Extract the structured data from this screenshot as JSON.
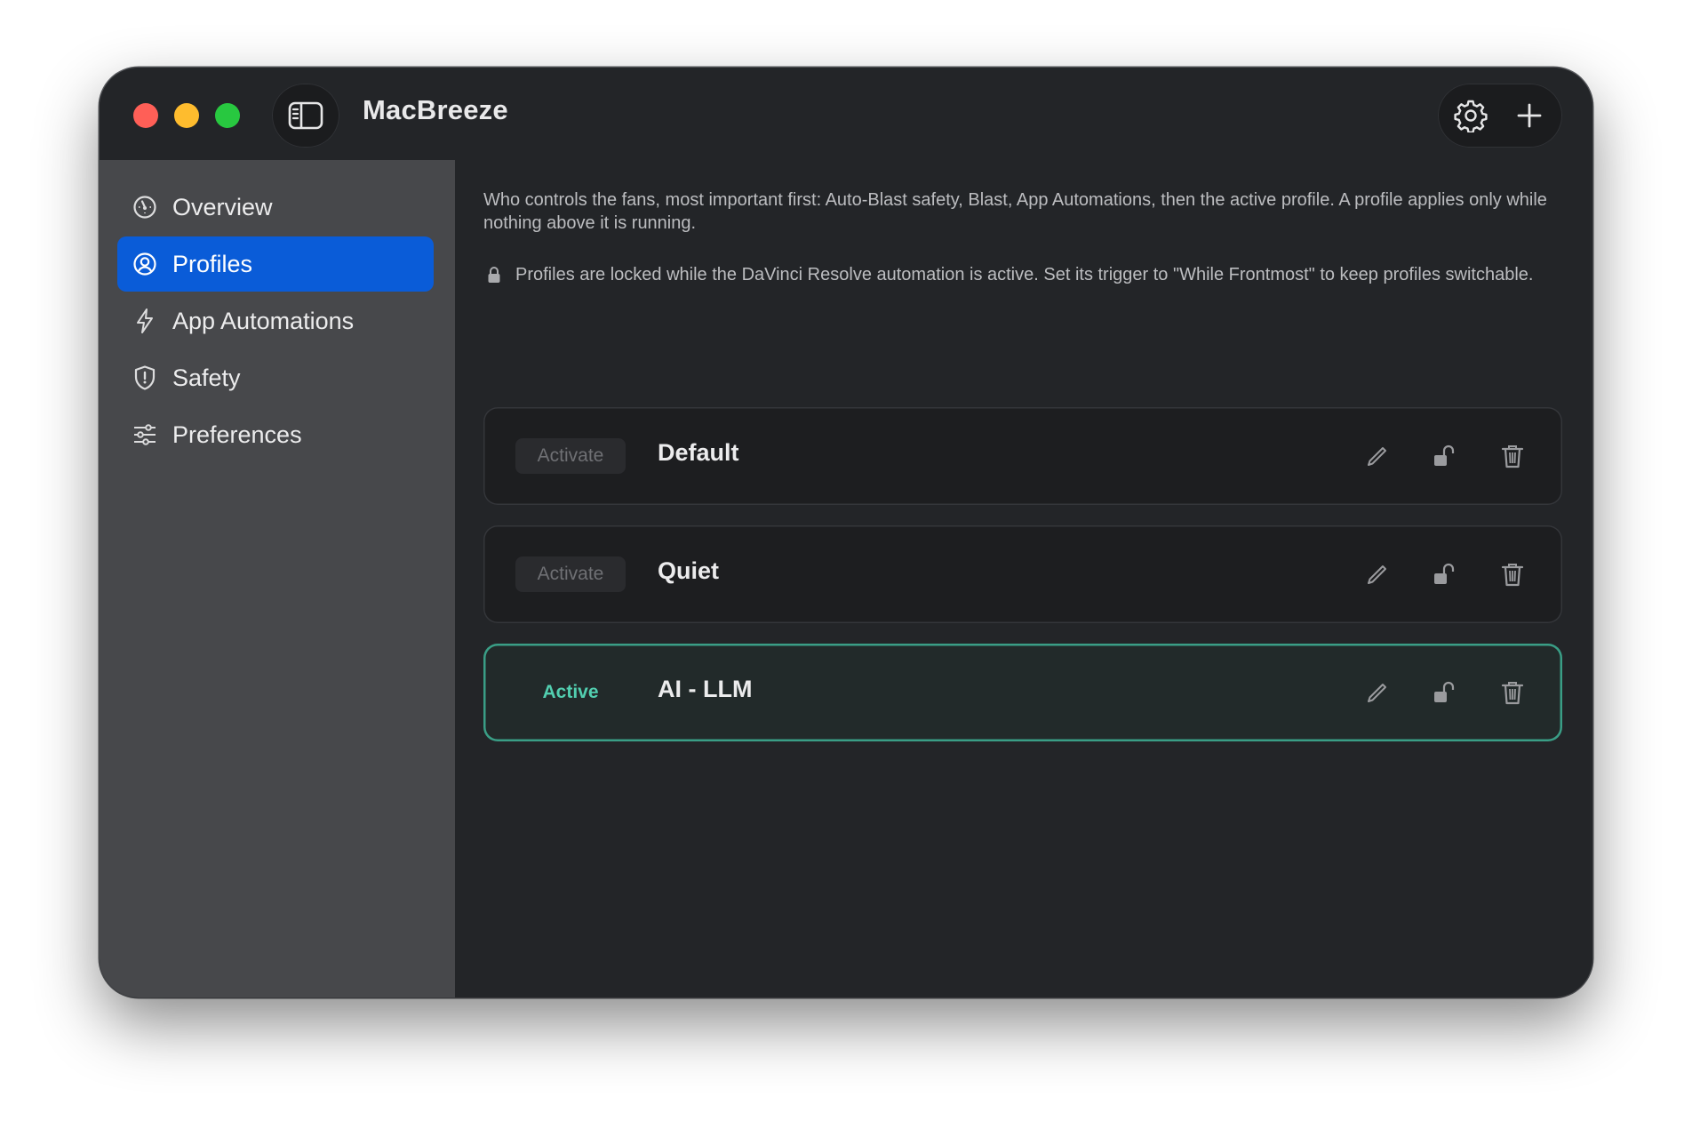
{
  "app": {
    "title": "MacBreeze"
  },
  "toolbar": {
    "sidebar_toggle_icon": "sidebar-left-icon",
    "settings_icon": "gear-icon",
    "add_icon": "plus-icon"
  },
  "sidebar": {
    "items": [
      {
        "label": "Overview",
        "icon": "gauge-icon",
        "selected": false
      },
      {
        "label": "Profiles",
        "icon": "person-circle-icon",
        "selected": true
      },
      {
        "label": "App Automations",
        "icon": "bolt-icon",
        "selected": false
      },
      {
        "label": "Safety",
        "icon": "shield-icon",
        "selected": false
      },
      {
        "label": "Preferences",
        "icon": "sliders-icon",
        "selected": false
      }
    ]
  },
  "main": {
    "intro": "Who controls the fans, most important first: Auto-Blast safety, Blast, App Automations, then the active profile. A profile applies only while nothing above it is running.",
    "lock_note": "Profiles are locked while the DaVinci Resolve automation is active. Set its trigger to \"While Frontmost\" to keep profiles switchable.",
    "profiles": [
      {
        "name": "Default",
        "status_label": "Activate",
        "active": false
      },
      {
        "name": "Quiet",
        "status_label": "Activate",
        "active": false
      },
      {
        "name": "AI - LLM",
        "status_label": "Active",
        "active": true
      }
    ]
  },
  "colors": {
    "accent_selected": "#0a5cd8",
    "active_green": "#52cfb0",
    "active_border": "#3a9e86",
    "close": "#ff5f57",
    "minimize": "#febc2e",
    "zoom": "#28c840"
  }
}
